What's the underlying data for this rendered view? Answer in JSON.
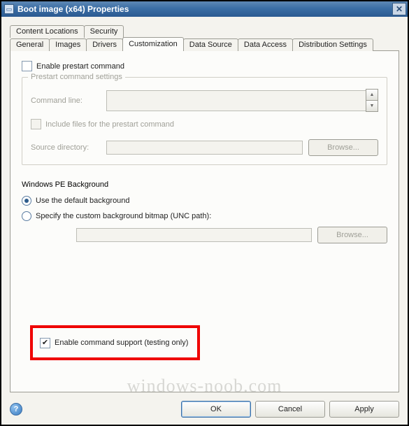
{
  "title": "Boot image (x64) Properties",
  "tabs": {
    "row1": [
      "Content Locations",
      "Security"
    ],
    "row2": [
      "General",
      "Images",
      "Drivers",
      "Customization",
      "Data Source",
      "Data Access",
      "Distribution Settings"
    ],
    "selected": "Customization"
  },
  "customization": {
    "enable_prestart_label": "Enable prestart command",
    "prestart_group_legend": "Prestart command settings",
    "command_line_label": "Command line:",
    "include_files_label": "Include files for the prestart command",
    "source_dir_label": "Source directory:",
    "browse_label": "Browse...",
    "pe_bg_title": "Windows PE Background",
    "radio_default_label": "Use the default background",
    "radio_custom_label": "Specify the custom background bitmap (UNC path):",
    "enable_cmd_support_label": "Enable command support (testing only)",
    "enable_cmd_support_checked": true,
    "radio_default_selected": true
  },
  "buttons": {
    "ok": "OK",
    "cancel": "Cancel",
    "apply": "Apply"
  },
  "watermark": "windows-noob.com"
}
